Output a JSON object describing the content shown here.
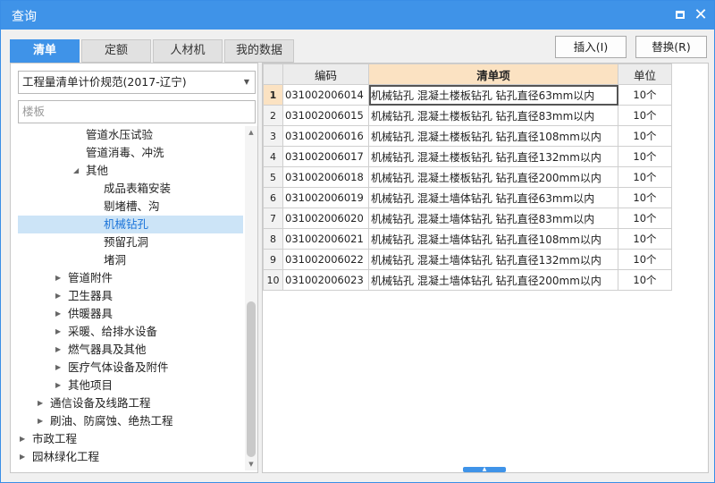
{
  "window": {
    "title": "查询"
  },
  "tabs": [
    {
      "label": "清单",
      "active": true
    },
    {
      "label": "定额",
      "active": false
    },
    {
      "label": "人材机",
      "active": false
    },
    {
      "label": "我的数据",
      "active": false
    }
  ],
  "actions": {
    "insert_label": "插入(I)",
    "replace_label": "替换(R)"
  },
  "left": {
    "spec_select": "工程量清单计价规范(2017-辽宁)",
    "search_placeholder": "楼板"
  },
  "tree": [
    {
      "label": "管道水压试验",
      "level": 4,
      "arrow": ""
    },
    {
      "label": "管道消毒、冲洗",
      "level": 4,
      "arrow": ""
    },
    {
      "label": "其他",
      "level": 4,
      "arrow": "◢"
    },
    {
      "label": "成品表箱安装",
      "level": 5,
      "arrow": ""
    },
    {
      "label": "剔堵槽、沟",
      "level": 5,
      "arrow": ""
    },
    {
      "label": "机械钻孔",
      "level": 5,
      "arrow": "",
      "selected": true
    },
    {
      "label": "预留孔洞",
      "level": 5,
      "arrow": ""
    },
    {
      "label": "堵洞",
      "level": 5,
      "arrow": ""
    },
    {
      "label": "管道附件",
      "level": 3,
      "arrow": "▶"
    },
    {
      "label": "卫生器具",
      "level": 3,
      "arrow": "▶"
    },
    {
      "label": "供暖器具",
      "level": 3,
      "arrow": "▶"
    },
    {
      "label": "采暖、给排水设备",
      "level": 3,
      "arrow": "▶"
    },
    {
      "label": "燃气器具及其他",
      "level": 3,
      "arrow": "▶"
    },
    {
      "label": "医疗气体设备及附件",
      "level": 3,
      "arrow": "▶"
    },
    {
      "label": "其他项目",
      "level": 3,
      "arrow": "▶"
    },
    {
      "label": "通信设备及线路工程",
      "level": 2,
      "arrow": "▶"
    },
    {
      "label": "刷油、防腐蚀、绝热工程",
      "level": 2,
      "arrow": "▶"
    },
    {
      "label": "市政工程",
      "level": 1,
      "arrow": "▶"
    },
    {
      "label": "园林绿化工程",
      "level": 1,
      "arrow": "▶"
    }
  ],
  "grid": {
    "headers": {
      "code": "编码",
      "name": "清单项",
      "unit": "单位"
    },
    "rows": [
      {
        "n": "1",
        "code": "031002006014",
        "name": "机械钻孔 混凝土楼板钻孔 钻孔直径63mm以内",
        "unit": "10个"
      },
      {
        "n": "2",
        "code": "031002006015",
        "name": "机械钻孔 混凝土楼板钻孔 钻孔直径83mm以内",
        "unit": "10个"
      },
      {
        "n": "3",
        "code": "031002006016",
        "name": "机械钻孔 混凝土楼板钻孔 钻孔直径108mm以内",
        "unit": "10个"
      },
      {
        "n": "4",
        "code": "031002006017",
        "name": "机械钻孔 混凝土楼板钻孔 钻孔直径132mm以内",
        "unit": "10个"
      },
      {
        "n": "5",
        "code": "031002006018",
        "name": "机械钻孔 混凝土楼板钻孔 钻孔直径200mm以内",
        "unit": "10个"
      },
      {
        "n": "6",
        "code": "031002006019",
        "name": "机械钻孔 混凝土墙体钻孔 钻孔直径63mm以内",
        "unit": "10个"
      },
      {
        "n": "7",
        "code": "031002006020",
        "name": "机械钻孔 混凝土墙体钻孔 钻孔直径83mm以内",
        "unit": "10个"
      },
      {
        "n": "8",
        "code": "031002006021",
        "name": "机械钻孔 混凝土墙体钻孔 钻孔直径108mm以内",
        "unit": "10个"
      },
      {
        "n": "9",
        "code": "031002006022",
        "name": "机械钻孔 混凝土墙体钻孔 钻孔直径132mm以内",
        "unit": "10个"
      },
      {
        "n": "10",
        "code": "031002006023",
        "name": "机械钻孔 混凝土墙体钻孔 钻孔直径200mm以内",
        "unit": "10个"
      }
    ]
  },
  "icons": {
    "maximize": "maximize-icon",
    "close": "close-icon",
    "dropdown": "chevron-down-icon",
    "splitter": "chevron-up-icon"
  },
  "colors": {
    "accent": "#3f93e8",
    "selected_bg": "#cce4f7",
    "active_header": "#fbe2c2"
  }
}
